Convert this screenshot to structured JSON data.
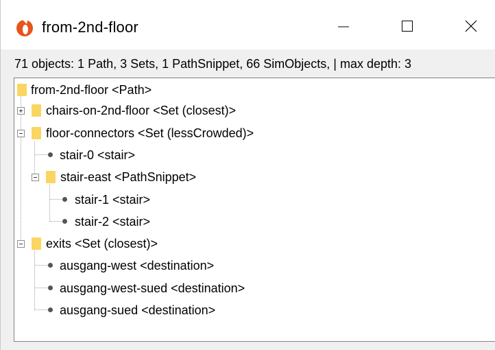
{
  "window": {
    "title": "from-2nd-floor",
    "app_icon": "app-logo-icon",
    "controls": {
      "minimize": "minimize-icon",
      "maximize": "maximize-icon",
      "close": "close-icon"
    }
  },
  "summary": "71 objects: 1 Path, 3 Sets, 1 PathSnippet, 66 SimObjects, | max depth: 3",
  "tree": {
    "root": "from-2nd-floor <Path>",
    "chairs": "chairs-on-2nd-floor <Set (closest)>",
    "floor_connectors": "floor-connectors <Set (lessCrowded)>",
    "stair_0": "stair-0 <stair>",
    "stair_east": "stair-east <PathSnippet>",
    "stair_1": "stair-1 <stair>",
    "stair_2": "stair-2 <stair>",
    "exits": "exits <Set (closest)>",
    "ausgang_west": "ausgang-west <destination>",
    "ausgang_west_sued": "ausgang-west-sued <destination>",
    "ausgang_sued": "ausgang-sued <destination>",
    "icons": {
      "folder": "folder-icon",
      "leaf": "bullet-icon",
      "expanded": "minus-icon",
      "collapsed": "plus-icon"
    }
  }
}
